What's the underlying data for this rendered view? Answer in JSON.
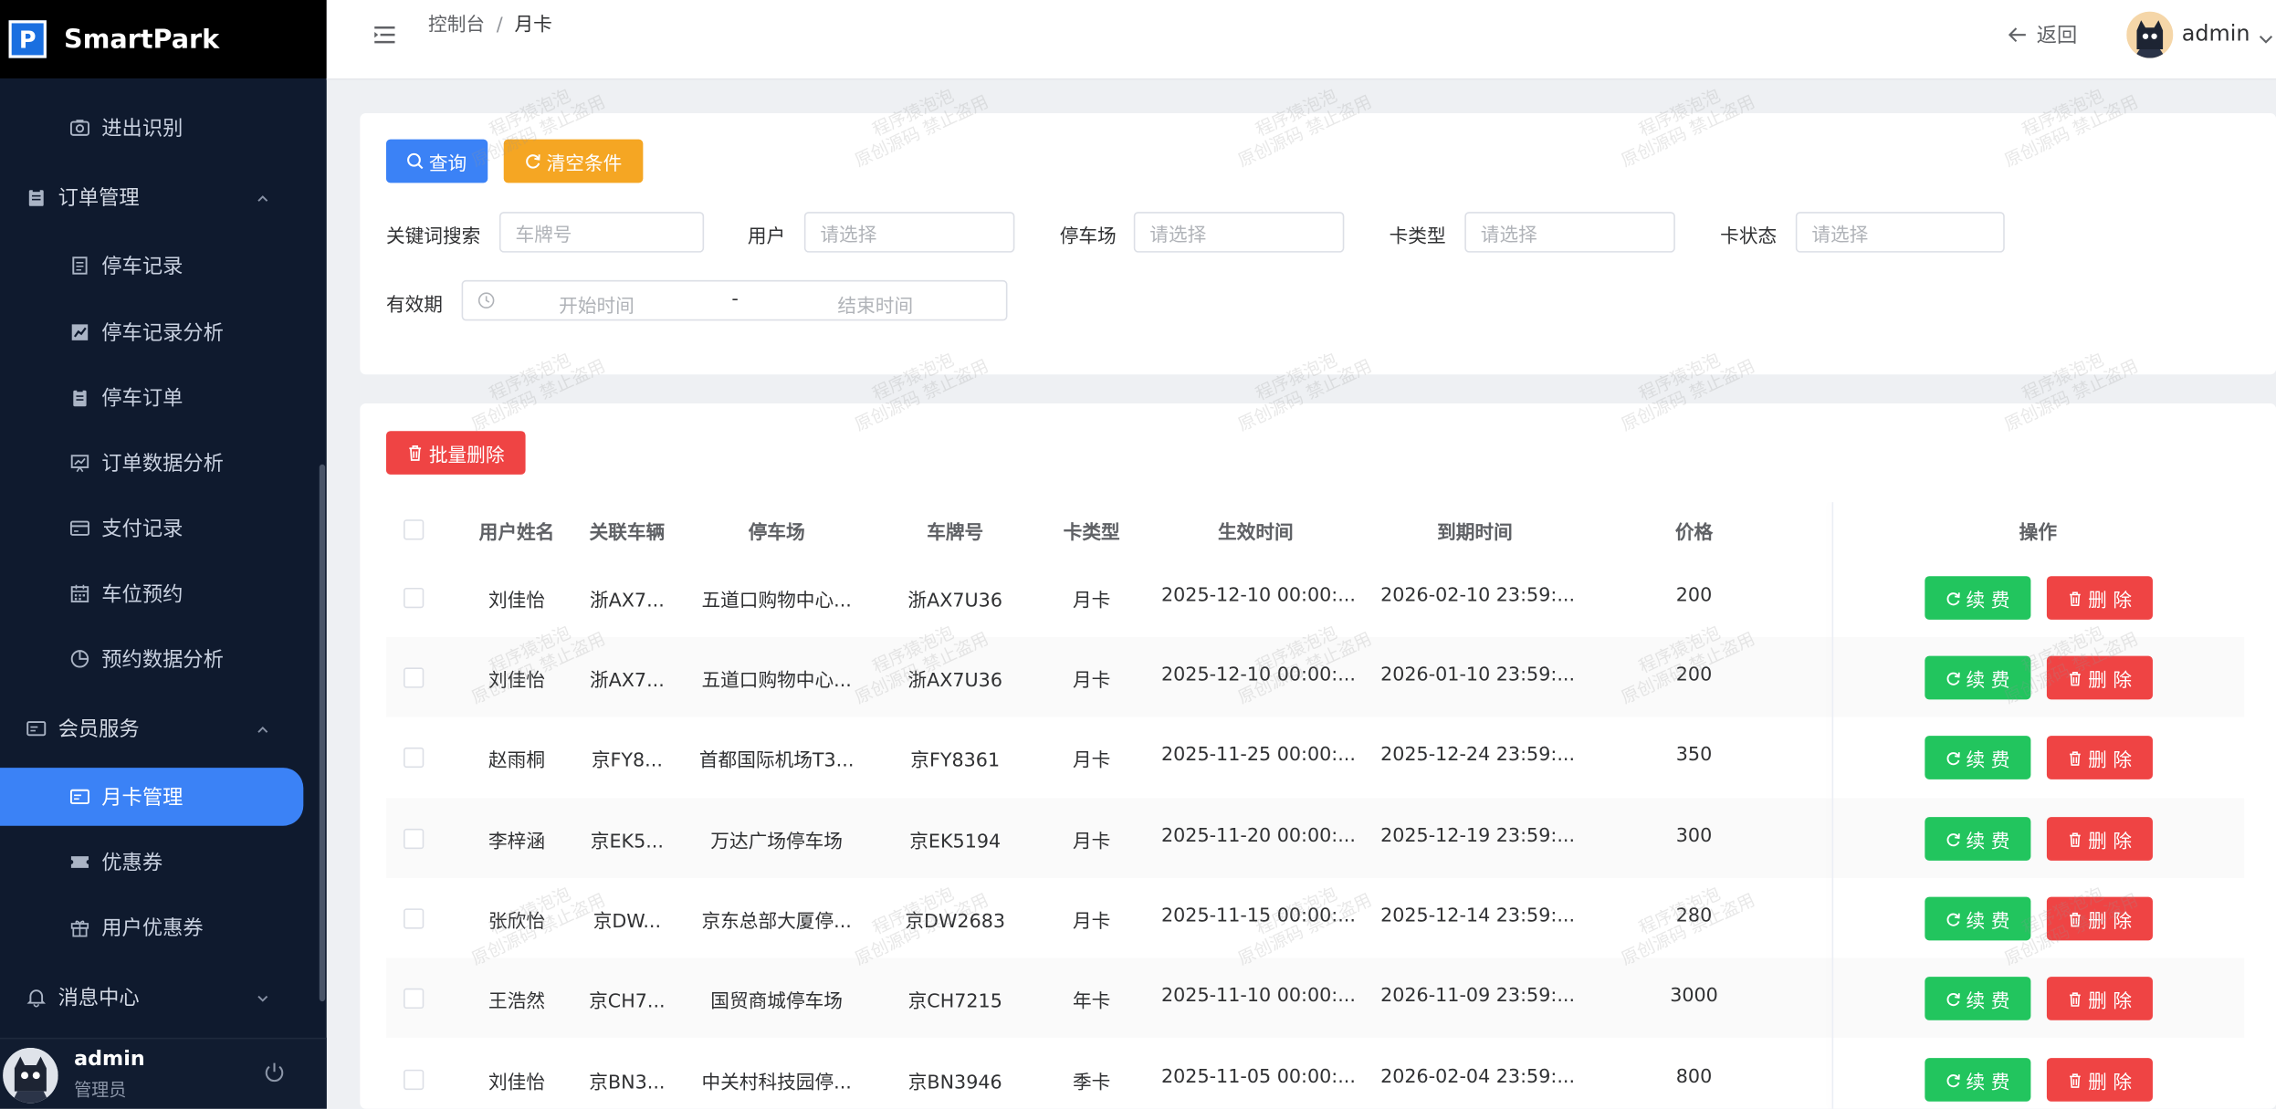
{
  "app": {
    "name": "SmartPark",
    "logo_letter": "P"
  },
  "sidebar": {
    "items": [
      {
        "label": "进出识别",
        "icon": "camera-icon"
      },
      {
        "label": "订单管理",
        "icon": "clipboard-icon"
      },
      {
        "label": "停车记录",
        "icon": "document-icon"
      },
      {
        "label": "停车记录分析",
        "icon": "line-chart-icon"
      },
      {
        "label": "停车订单",
        "icon": "clipboard-icon"
      },
      {
        "label": "订单数据分析",
        "icon": "presentation-chart-icon"
      },
      {
        "label": "支付记录",
        "icon": "credit-card-icon"
      },
      {
        "label": "车位预约",
        "icon": "calendar-icon"
      },
      {
        "label": "预约数据分析",
        "icon": "pie-chart-icon"
      },
      {
        "label": "会员服务",
        "icon": "membership-card-icon"
      },
      {
        "label": "月卡管理",
        "icon": "membership-card-icon"
      },
      {
        "label": "优惠券",
        "icon": "ticket-icon"
      },
      {
        "label": "用户优惠券",
        "icon": "gift-icon"
      },
      {
        "label": "消息中心",
        "icon": "bell-icon"
      }
    ],
    "user": {
      "name": "admin",
      "role": "管理员"
    }
  },
  "header": {
    "breadcrumb": [
      "控制台",
      "月卡"
    ],
    "breadcrumb_sep": "/",
    "back_label": "返回",
    "user_name": "admin"
  },
  "filters": {
    "query_label": "查询",
    "clear_label": "清空条件",
    "keyword_label": "关键词搜索",
    "keyword_placeholder": "车牌号",
    "user_label": "用户",
    "user_placeholder": "请选择",
    "lot_label": "停车场",
    "lot_placeholder": "请选择",
    "cardtype_label": "卡类型",
    "cardtype_placeholder": "请选择",
    "status_label": "卡状态",
    "status_placeholder": "请选择",
    "valid_label": "有效期",
    "start_placeholder": "开始时间",
    "range_sep": "-",
    "end_placeholder": "结束时间"
  },
  "table": {
    "batch_delete_label": "批量删除",
    "columns": [
      "用户姓名",
      "关联车辆",
      "停车场",
      "车牌号",
      "卡类型",
      "生效时间",
      "到期时间",
      "价格",
      "操作"
    ],
    "renew_label": "续 费",
    "delete_label": "删 除",
    "rows": [
      {
        "name": "刘佳怡",
        "vehicle": "浙AX7...",
        "lot": "五道口购物中心...",
        "plate": "浙AX7U36",
        "type": "月卡",
        "start": "2025-12-10 00:00:...",
        "end": "2026-02-10 23:59:...",
        "price": "200"
      },
      {
        "name": "刘佳怡",
        "vehicle": "浙AX7...",
        "lot": "五道口购物中心...",
        "plate": "浙AX7U36",
        "type": "月卡",
        "start": "2025-12-10 00:00:...",
        "end": "2026-01-10 23:59:...",
        "price": "200"
      },
      {
        "name": "赵雨桐",
        "vehicle": "京FY8...",
        "lot": "首都国际机场T3...",
        "plate": "京FY8361",
        "type": "月卡",
        "start": "2025-11-25 00:00:...",
        "end": "2025-12-24 23:59:...",
        "price": "350"
      },
      {
        "name": "李梓涵",
        "vehicle": "京EK5...",
        "lot": "万达广场停车场",
        "plate": "京EK5194",
        "type": "月卡",
        "start": "2025-11-20 00:00:...",
        "end": "2025-12-19 23:59:...",
        "price": "300"
      },
      {
        "name": "张欣怡",
        "vehicle": "京DW...",
        "lot": "京东总部大厦停...",
        "plate": "京DW2683",
        "type": "月卡",
        "start": "2025-11-15 00:00:...",
        "end": "2025-12-14 23:59:...",
        "price": "280"
      },
      {
        "name": "王浩然",
        "vehicle": "京CH7...",
        "lot": "国贸商城停车场",
        "plate": "京CH7215",
        "type": "年卡",
        "start": "2025-11-10 00:00:...",
        "end": "2026-11-09 23:59:...",
        "price": "3000"
      },
      {
        "name": "刘佳怡",
        "vehicle": "京BN3...",
        "lot": "中关村科技园停...",
        "plate": "京BN3946",
        "type": "季卡",
        "start": "2025-11-05 00:00:...",
        "end": "2026-02-04 23:59:...",
        "price": "800"
      }
    ]
  },
  "watermark": [
    "程序猿泡泡",
    "原创源码 禁止盗用"
  ],
  "colors": {
    "primary": "#3b82f6",
    "warning": "#f5a623",
    "danger": "#ef4444",
    "success": "#22c55e",
    "sidebar": "#0f1a2e"
  }
}
